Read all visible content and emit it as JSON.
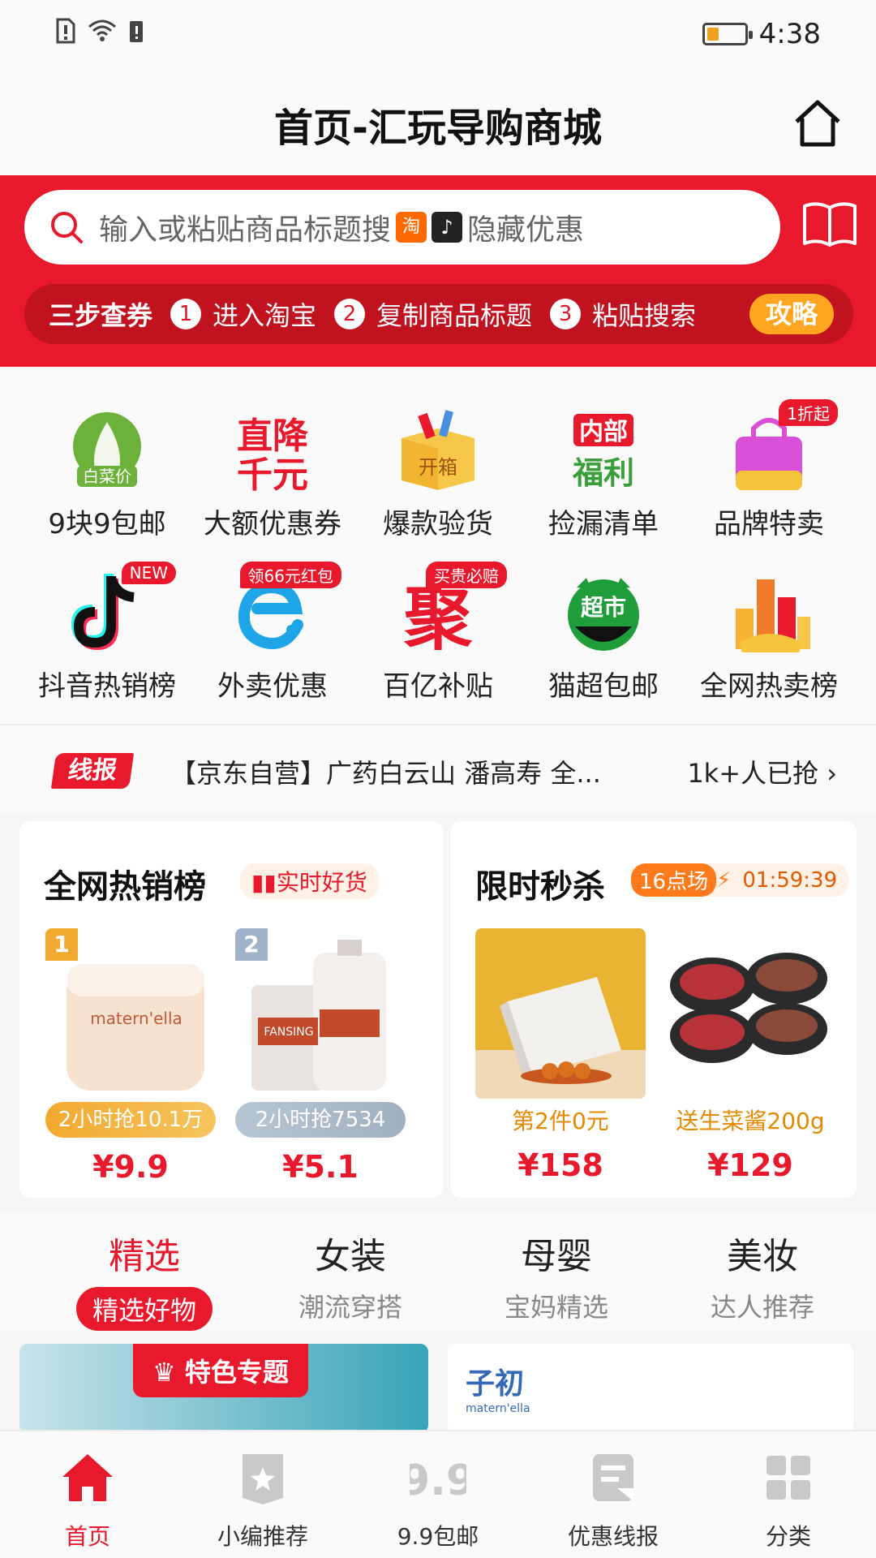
{
  "status": {
    "time": "4:38"
  },
  "header": {
    "title": "首页-汇玩导购商城"
  },
  "search": {
    "placeholder_prefix": "输入或粘贴商品标题搜",
    "placeholder_suffix": "隐藏优惠",
    "taobao_badge": "淘",
    "douyin_badge": "♪"
  },
  "steps": {
    "lead": "三步查券",
    "items": [
      {
        "num": "1",
        "label": "进入淘宝"
      },
      {
        "num": "2",
        "label": "复制商品标题"
      },
      {
        "num": "3",
        "label": "粘贴搜索"
      }
    ],
    "guide_label": "攻略"
  },
  "grid": {
    "items": [
      {
        "label": "9块9包邮",
        "icon_text": "白菜价",
        "icon": "cabbage-icon"
      },
      {
        "label": "大额优惠券",
        "icon_text": "直降千元",
        "icon": "discount-text-icon"
      },
      {
        "label": "爆款验货",
        "icon_text": "开箱",
        "icon": "open-box-icon"
      },
      {
        "label": "捡漏清单",
        "icon_text": "内部福利",
        "icon": "internal-welfare-icon"
      },
      {
        "label": "品牌特卖",
        "icon_text": "",
        "tag": "1折起",
        "icon": "shopping-bag-icon"
      },
      {
        "label": "抖音热销榜",
        "icon_text": "",
        "tag": "NEW",
        "icon": "douyin-icon"
      },
      {
        "label": "外卖优惠",
        "icon_text": "",
        "tag": "领66元红包",
        "icon": "eleme-icon"
      },
      {
        "label": "百亿补贴",
        "icon_text": "聚",
        "tag": "买贵必赔",
        "icon": "ju-icon"
      },
      {
        "label": "猫超包邮",
        "icon_text": "超市",
        "icon": "tmall-supermarket-icon"
      },
      {
        "label": "全网热卖榜",
        "icon_text": "",
        "icon": "bar-chart-icon"
      }
    ]
  },
  "news": {
    "tag": "线报",
    "text": "【京东自营】广药白云山 潘高寿 全...",
    "count": "1k+人已抢"
  },
  "hot": {
    "title": "全网热销榜",
    "tag": "实时好货",
    "products": [
      {
        "rank": "1",
        "sold": "2小时抢10.1万",
        "price": "¥9.9",
        "brand": "matern'ella"
      },
      {
        "rank": "2",
        "sold": "2小时抢7534",
        "price": "¥5.1",
        "brand": "FANSING"
      }
    ]
  },
  "seckill": {
    "title": "限时秒杀",
    "session": "16点场",
    "countdown": "01:59:39",
    "products": [
      {
        "perk": "第2件0元",
        "price": "¥158"
      },
      {
        "perk": "送生菜酱200g",
        "price": "¥129"
      }
    ]
  },
  "tabs": [
    {
      "title": "精选",
      "sub": "精选好物"
    },
    {
      "title": "女装",
      "sub": "潮流穿搭"
    },
    {
      "title": "母婴",
      "sub": "宝妈精选"
    },
    {
      "title": "美妆",
      "sub": "达人推荐"
    }
  ],
  "banners": {
    "left_badge": "特色专题",
    "right_brand": "子初",
    "right_brand_sub": "matern'ella"
  },
  "nav": [
    {
      "label": "首页",
      "icon": "home-icon"
    },
    {
      "label": "小编推荐",
      "icon": "editor-pick-icon"
    },
    {
      "label": "9.9包邮",
      "icon": "nine-nine-icon"
    },
    {
      "label": "优惠线报",
      "icon": "deal-news-icon"
    },
    {
      "label": "分类",
      "icon": "category-grid-icon"
    }
  ],
  "colors": {
    "brand_red": "#e8192c",
    "accent_orange": "#ffa51f"
  }
}
